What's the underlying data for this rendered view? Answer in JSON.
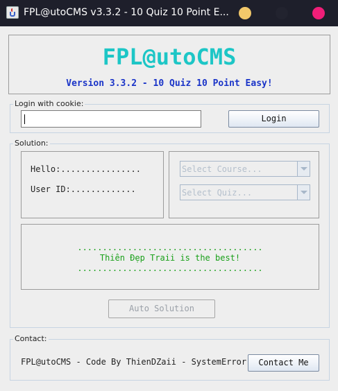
{
  "window": {
    "title": "FPL@utoCMS v3.3.2 - 10 Quiz 10 Point E...",
    "controls": {
      "minimize_color": "#f2c86a",
      "maximize_color": "#22232f",
      "close_color": "#f01e78"
    }
  },
  "header": {
    "brand": "FPL@utoCMS",
    "version": "Version 3.3.2 - 10 Quiz 10 Point Easy!",
    "brand_color": "#1dc6c6",
    "version_color": "#1a34c8"
  },
  "login": {
    "legend": "Login with cookie:",
    "cookie_value": "",
    "button_label": "Login"
  },
  "solution": {
    "legend": "Solution:",
    "hello_line": "Hello:................",
    "user_id_line": "User ID:.............",
    "course_select": "Select Course...",
    "quiz_select": "Select Quiz...",
    "message": {
      "dots_top": ".....................................",
      "text": "Thiên Đẹp Traii is the best!",
      "dots_bottom": ".....................................",
      "color": "#19a019"
    },
    "auto_button_label": "Auto Solution"
  },
  "contact": {
    "legend": "Contact:",
    "credit": "FPL@utoCMS - Code By ThienDZaii - SystemError",
    "button_label": "Contact Me"
  }
}
